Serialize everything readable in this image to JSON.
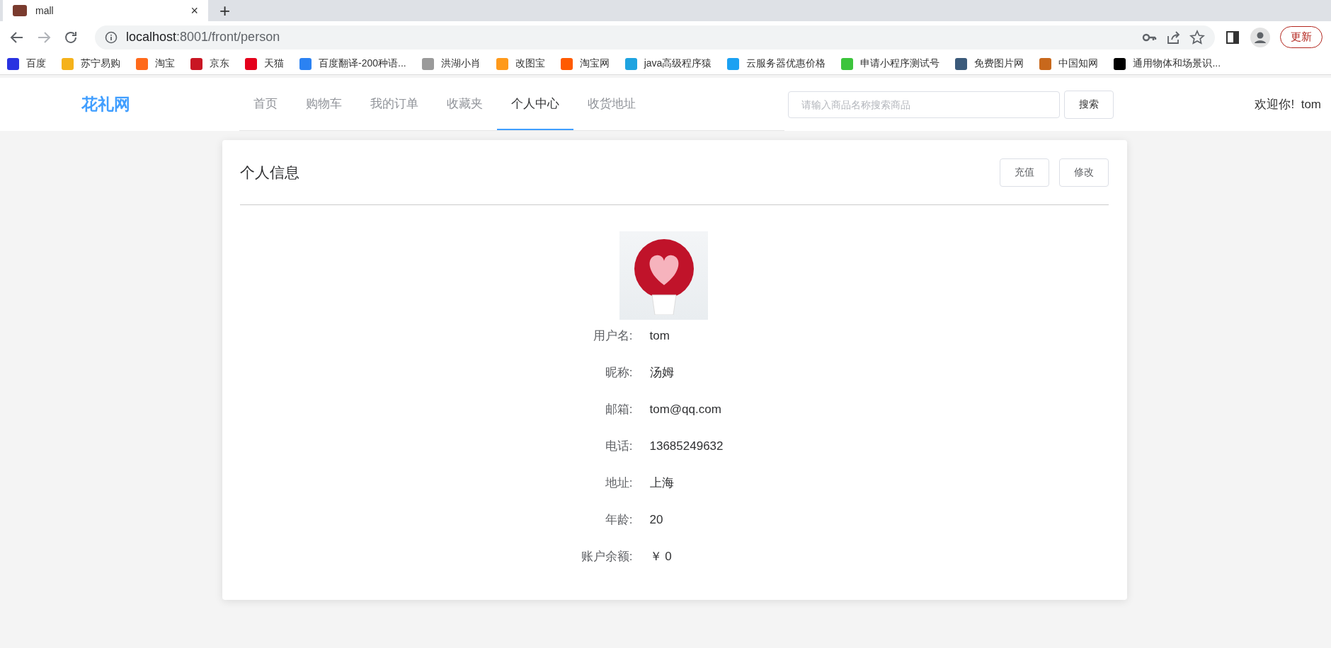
{
  "browser": {
    "tab_title": "mall",
    "new_tab": "+",
    "close": "×",
    "url_host": "localhost",
    "url_path": ":8001/front/person",
    "update_button": "更新",
    "bookmarks": [
      {
        "label": "百度",
        "color": "#2932e1"
      },
      {
        "label": "苏宁易购",
        "color": "#f5b21b"
      },
      {
        "label": "淘宝",
        "color": "#ff6a1b"
      },
      {
        "label": "京东",
        "color": "#c91623"
      },
      {
        "label": "天猫",
        "color": "#e4001b"
      },
      {
        "label": "百度翻译-200种语...",
        "color": "#2b82f2"
      },
      {
        "label": "洪湖小肖",
        "color": "#9a9a9a"
      },
      {
        "label": "改图宝",
        "color": "#ff9a1b"
      },
      {
        "label": "淘宝网",
        "color": "#ff5a00"
      },
      {
        "label": "java高级程序猿",
        "color": "#1ea3e0"
      },
      {
        "label": "云服务器优惠价格",
        "color": "#1ba1f2"
      },
      {
        "label": "申请小程序测试号",
        "color": "#3cc43c"
      },
      {
        "label": "免费图片网",
        "color": "#3b5a7a"
      },
      {
        "label": "中国知网",
        "color": "#c8681c"
      },
      {
        "label": "通用物体和场景识...",
        "color": "#000000"
      }
    ]
  },
  "header": {
    "logo": "花礼网",
    "nav": [
      {
        "label": "首页",
        "selected": false
      },
      {
        "label": "购物车",
        "selected": false
      },
      {
        "label": "我的订单",
        "selected": false
      },
      {
        "label": "收藏夹",
        "selected": false
      },
      {
        "label": "个人中心",
        "selected": true
      },
      {
        "label": "收货地址",
        "selected": false
      }
    ],
    "search": {
      "placeholder": "请输入商品名称搜索商品"
    },
    "search_button": "搜索",
    "welcome": "欢迎你!  tom"
  },
  "card": {
    "title": "个人信息",
    "buttons": [
      "充值",
      "修改"
    ],
    "fields": [
      {
        "label": "用户名:",
        "value": "tom"
      },
      {
        "label": "昵称:",
        "value": "汤姆"
      },
      {
        "label": "邮箱:",
        "value": "tom@qq.com"
      },
      {
        "label": "电话:",
        "value": "13685249632"
      },
      {
        "label": "地址:",
        "value": "上海"
      },
      {
        "label": "年龄:",
        "value": "20"
      },
      {
        "label": "账户余额:",
        "value": "￥ 0"
      }
    ]
  }
}
